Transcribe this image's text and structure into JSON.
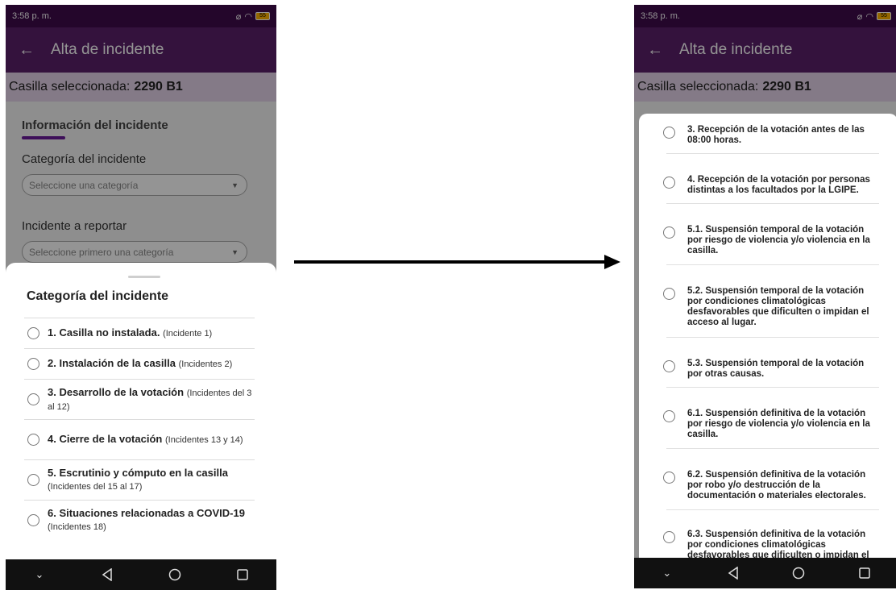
{
  "status": {
    "time": "3:58 p. m.",
    "battery": "55"
  },
  "left": {
    "title": "Alta de incidente",
    "casilla_prefix": "Casilla seleccionada:",
    "casilla_value": "2290 B1",
    "section_title": "Información del incidente",
    "field1_label": "Categoría del incidente",
    "field1_placeholder": "Seleccione una categoría",
    "field2_label": "Incidente a reportar",
    "field2_placeholder": "Seleccione primero una categoría",
    "sheet_title": "Categoría del incidente",
    "options": [
      {
        "main": "1. Casilla no instalada.",
        "note": "(Incidente 1)"
      },
      {
        "main": "2. Instalación de la casilla",
        "note": "(Incidentes 2)"
      },
      {
        "main": "3. Desarrollo de la votación",
        "note": "(Incidentes del 3 al 12)"
      },
      {
        "main": "4. Cierre de la votación",
        "note": "(Incidentes 13 y 14)"
      },
      {
        "main": "5. Escrutinio y cómputo en la casilla",
        "note": "(Incidentes del 15 al 17)"
      },
      {
        "main": "6. Situaciones relacionadas a COVID-19",
        "note": "(Incidentes 18)"
      }
    ]
  },
  "right": {
    "title": "Alta de incidente",
    "casilla_prefix": "Casilla seleccionada:",
    "casilla_value": "2290 B1",
    "items": [
      "3. Recepción de la votación antes de las 08:00 horas.",
      "4. Recepción de la votación por personas distintas a los facultados por la LGIPE.",
      "5.1. Suspensión temporal de la votación por riesgo de violencia y/o violencia en la casilla.",
      "5.2. Suspensión temporal de la votación por condiciones climatológicas desfavorables que dificulten o impidan el acceso al lugar.",
      "5.3. Suspensión temporal de la votación por otras causas.",
      "6.1. Suspensión definitiva de la votación por riesgo de violencia y/o violencia en la casilla.",
      "6.2. Suspensión definitiva de la votación por robo y/o destrucción de la documentación o materiales electorales.",
      "6.3. Suspensión definitiva de la votación por condiciones climatológicas desfavorables que dificulten o impidan el"
    ]
  },
  "colors": {
    "status_bar": "#3f0b4a",
    "app_bar": "#5a1f69",
    "accent": "#6a1b9a",
    "casilla_bar": "#e4d3e8"
  }
}
